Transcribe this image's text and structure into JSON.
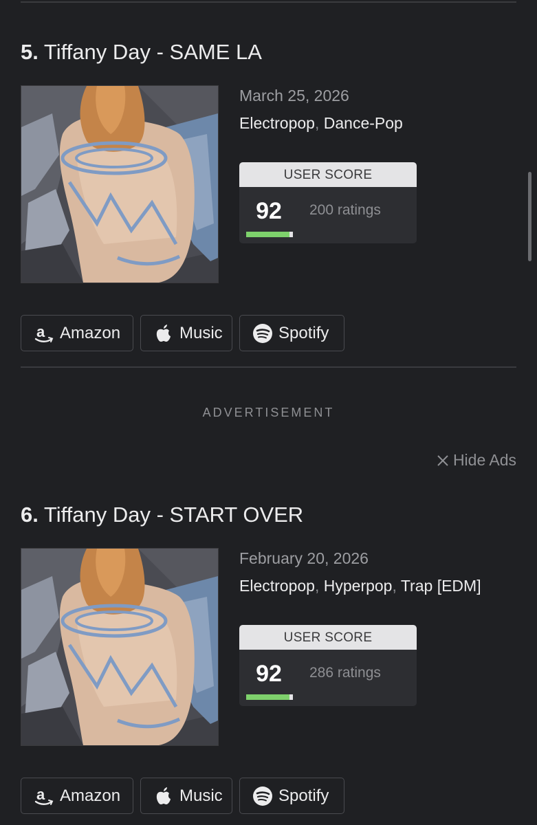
{
  "entries": [
    {
      "rank": "5.",
      "title": "Tiffany Day - SAME LA",
      "date": "March 25, 2026",
      "genres": [
        "Electropop",
        "Dance-Pop"
      ],
      "score_header": "USER SCORE",
      "score": "92",
      "score_fraction": 0.92,
      "ratings": "200 ratings",
      "buttons": {
        "amazon": "Amazon",
        "music": "Music",
        "spotify": "Spotify"
      }
    },
    {
      "rank": "6.",
      "title": "Tiffany Day - START OVER",
      "date": "February 20, 2026",
      "genres": [
        "Electropop",
        "Hyperpop",
        "Trap [EDM]"
      ],
      "score_header": "USER SCORE",
      "score": "92",
      "score_fraction": 0.92,
      "ratings": "286 ratings",
      "buttons": {
        "amazon": "Amazon",
        "music": "Music",
        "spotify": "Spotify"
      }
    }
  ],
  "advertisement": "ADVERTISEMENT",
  "hide_ads": "Hide Ads",
  "colors": {
    "background": "#1f2023",
    "score_green": "#7ed16c",
    "score_header_bg": "#e4e4e6",
    "card_bg": "#2d2e32"
  },
  "icons": {
    "amazon": "amazon-logo-icon",
    "music": "apple-logo-icon",
    "spotify": "spotify-logo-icon",
    "hide": "close-icon"
  }
}
